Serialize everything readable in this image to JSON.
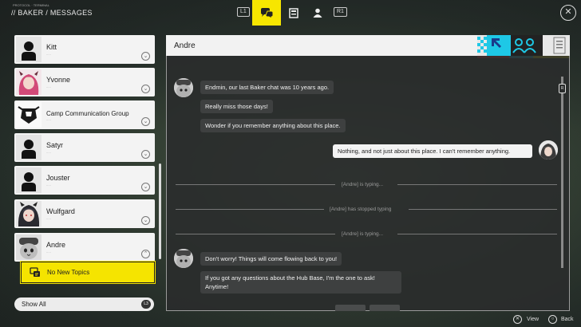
{
  "header": {
    "breadcrumb": "// BAKER / MESSAGES",
    "breadcrumb_sub": "PROTOCOL · TERMINAL",
    "left_button": "L1",
    "right_button": "R1",
    "close_symbol": "✕",
    "tabs": [
      {
        "icon": "chat-bubbles-icon",
        "active": true
      },
      {
        "icon": "document-icon",
        "active": false
      },
      {
        "icon": "person-icon",
        "active": false
      }
    ]
  },
  "contacts": [
    {
      "name": "Kitt",
      "avatar": "default-avatar"
    },
    {
      "name": "Yvonne",
      "avatar": "character-portrait"
    },
    {
      "name": "Camp Communication Group",
      "avatar": "group-emblem"
    },
    {
      "name": "Satyr",
      "avatar": "default-avatar"
    },
    {
      "name": "Jouster",
      "avatar": "default-avatar"
    },
    {
      "name": "Wulfgard",
      "avatar": "character-portrait"
    },
    {
      "name": "Andre",
      "avatar": "cat-portrait",
      "expanded": true
    }
  ],
  "topic_item": {
    "label": "No New Topics"
  },
  "filter": {
    "label": "Show All",
    "button": "L3"
  },
  "chat": {
    "title": "Andre",
    "messages": [
      {
        "from": "them",
        "text": "Endmin, our last Baker chat was 10 years ago."
      },
      {
        "from": "them",
        "text": "Really miss those days!"
      },
      {
        "from": "them",
        "text": "Wonder if you remember anything about this place."
      },
      {
        "from": "me",
        "text": "Nothing, and not just about this place. I can't remember anything."
      },
      {
        "from": "status",
        "text": "[Andre] is typing..."
      },
      {
        "from": "status",
        "text": "[Andre] has stopped typing"
      },
      {
        "from": "status",
        "text": "[Andre] is typing..."
      },
      {
        "from": "them",
        "text": "Don't worry! Things will come flowing back to you!"
      },
      {
        "from": "them",
        "text": "If you got any questions about the Hub Base, I'm the one to ask! Anytime!"
      }
    ],
    "scroll_button": "R"
  },
  "footer": {
    "view_label": "View",
    "back_label": "Back"
  },
  "colors": {
    "accent": "#f7e600",
    "panel": "#2a2c2c",
    "bubble": "#3e4040",
    "cyan": "#1ec8e6"
  }
}
